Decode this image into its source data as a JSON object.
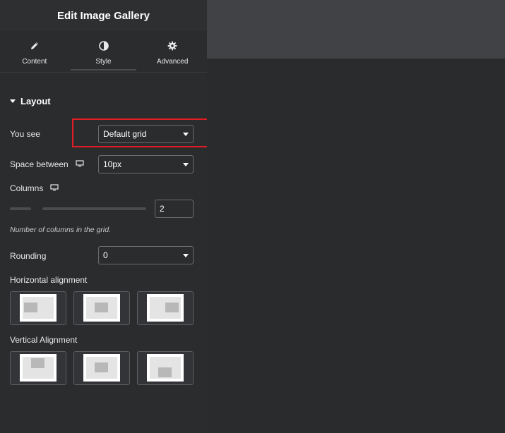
{
  "header": {
    "title": "Edit Image Gallery"
  },
  "tabs": [
    {
      "label": "Content",
      "icon": "pencil-icon"
    },
    {
      "label": "Style",
      "icon": "half-circle-icon",
      "active": true
    },
    {
      "label": "Advanced",
      "icon": "gear-icon"
    }
  ],
  "section": {
    "title": "Layout"
  },
  "you_see": {
    "label": "You see",
    "value": "Default grid"
  },
  "space_between": {
    "label": "Space between",
    "value": "10px"
  },
  "columns": {
    "label": "Columns",
    "value": "2",
    "hint": "Number of columns in the grid."
  },
  "rounding": {
    "label": "Rounding",
    "value": "0"
  },
  "horizontal_alignment": {
    "label": "Horizontal alignment",
    "options": [
      "left",
      "center",
      "right"
    ]
  },
  "vertical_alignment": {
    "label": "Vertical Alignment",
    "options": [
      "top",
      "middle",
      "bottom"
    ]
  },
  "colors": {
    "highlight": "#e11c22",
    "panel_bg": "#2b2c2e",
    "preview_top": "#404245"
  }
}
